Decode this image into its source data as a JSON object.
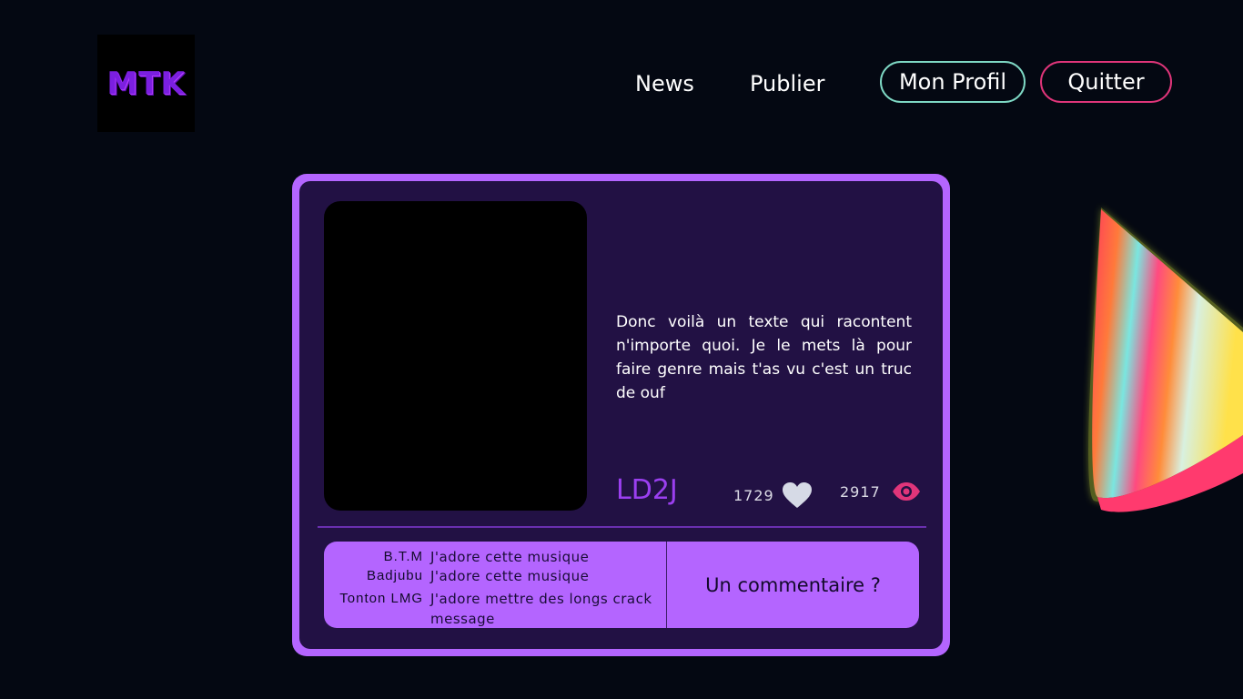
{
  "logo": {
    "text": "MTK"
  },
  "nav": {
    "news": "News",
    "publier": "Publier",
    "profil": "Mon Profil",
    "quitter": "Quitter"
  },
  "post": {
    "text": "Donc voilà un texte qui racontent n'importe quoi. Je le mets là pour faire genre mais t'as vu c'est un truc de ouf",
    "author": "LD2J",
    "likes": "1729",
    "views": "2917"
  },
  "comments": [
    {
      "name": "B.T.M",
      "text": "J'adore cette musique"
    },
    {
      "name": "Badjubu",
      "text": "J'adore cette musique"
    },
    {
      "name": "Tonton LMG",
      "text": "J'adore mettre des longs crack message"
    }
  ],
  "add_comment_label": "Un commentaire ?",
  "icons": {
    "likes": "heart-icon",
    "views": "eye-icon"
  },
  "colors": {
    "background": "#040812",
    "card_accent": "#b465ff",
    "card_inner": "#221144",
    "author": "#9b3ff0",
    "profil_border": "#7ed8c4",
    "quitter_border": "#e0357a",
    "eye_icon": "#e0357a"
  }
}
